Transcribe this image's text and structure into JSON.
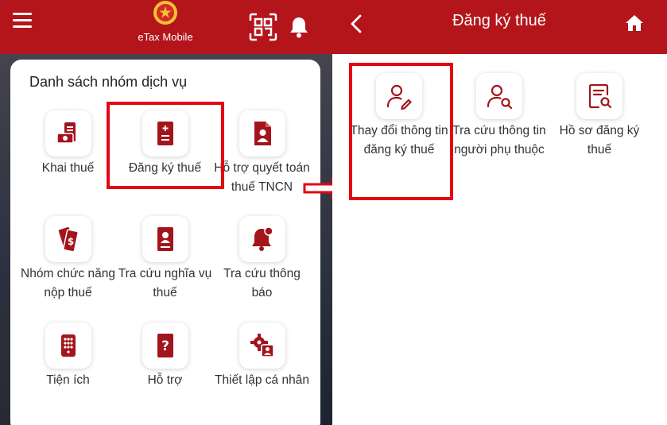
{
  "left": {
    "header": {
      "app_title": "eTax Mobile",
      "menu_icon": "hamburger-menu-icon",
      "qr_icon": "qr-scan-icon",
      "bell_icon": "bell-icon"
    },
    "card_title": "Danh sách nhóm dịch vụ",
    "tiles": [
      {
        "label": "Khai thuế",
        "icon": "tax-declaration-icon"
      },
      {
        "label": "Đăng ký thuế",
        "icon": "tax-registration-icon"
      },
      {
        "label": "Hỗ trợ quyết toán thuế TNCN",
        "icon": "personal-tax-settlement-icon"
      },
      {
        "label": "Nhóm chức năng nộp thuế",
        "icon": "tax-payment-icon"
      },
      {
        "label": "Tra cứu nghĩa vụ thuế",
        "icon": "tax-obligation-lookup-icon"
      },
      {
        "label": "Tra cứu thông báo",
        "icon": "notification-lookup-icon"
      },
      {
        "label": "Tiện ích",
        "icon": "utilities-icon"
      },
      {
        "label": "Hỗ trợ",
        "icon": "help-icon"
      },
      {
        "label": "Thiết lập cá nhân",
        "icon": "personal-settings-icon"
      }
    ]
  },
  "right": {
    "header": {
      "title": "Đăng ký thuế",
      "back_icon": "back-arrow-icon",
      "home_icon": "home-icon"
    },
    "tiles": [
      {
        "label": "Thay đổi thông tin đăng ký thuế",
        "icon": "edit-user-icon"
      },
      {
        "label": "Tra cứu thông tin người phụ thuộc",
        "icon": "search-user-icon"
      },
      {
        "label": "Hồ sơ đăng ký thuế",
        "icon": "document-search-icon"
      }
    ]
  },
  "colors": {
    "brand_red": "#b3151b",
    "icon_red": "#a3151c",
    "highlight_red": "#e30613"
  }
}
